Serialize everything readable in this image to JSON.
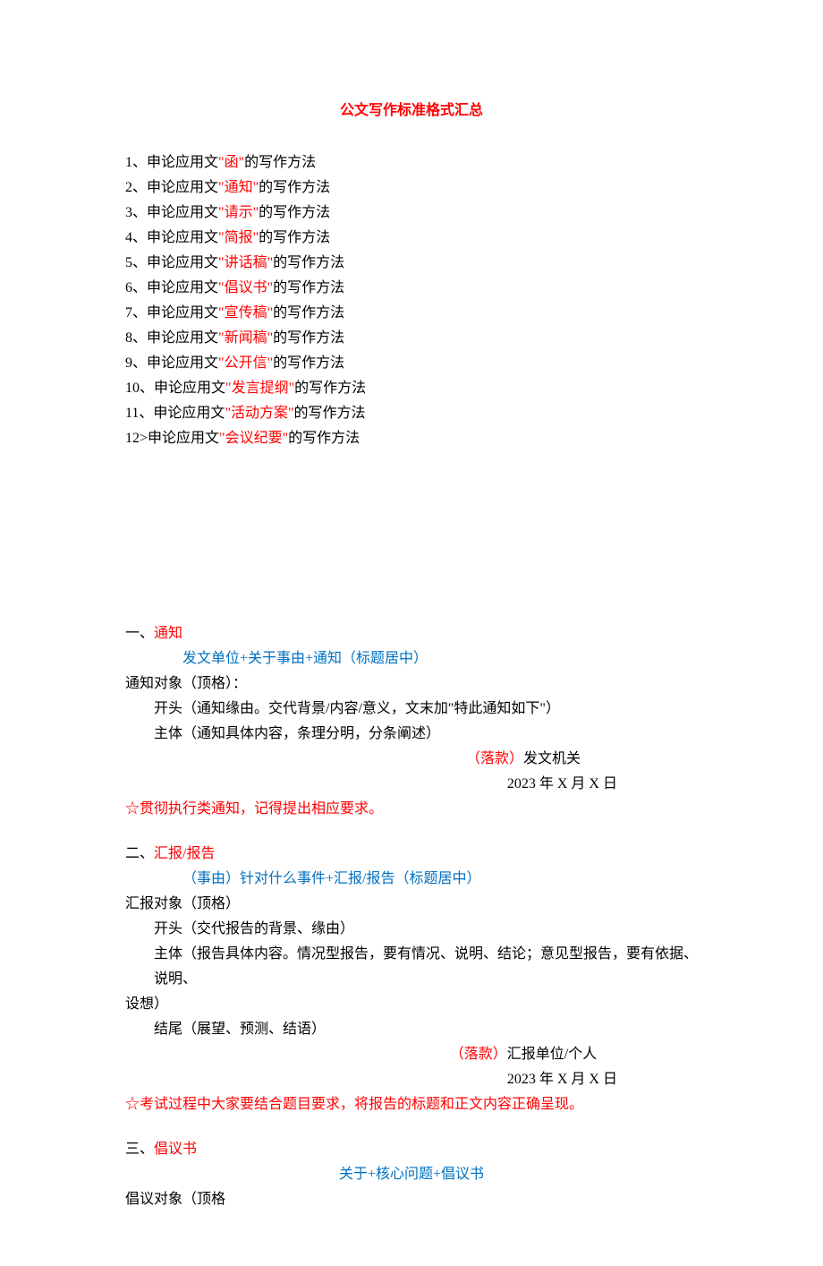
{
  "title": "公文写作标准格式汇总",
  "toc": [
    {
      "num": "1、",
      "pre": "申论应用文",
      "q1": "\"",
      "kw": "函",
      "q2": "\"",
      "suf": "的写作方法"
    },
    {
      "num": "2、",
      "pre": "申论应用文",
      "q1": "\"",
      "kw": "通知",
      "q2": "\"",
      "suf": "的写作方法"
    },
    {
      "num": "3、",
      "pre": "申论应用文",
      "q1": "\"",
      "kw": "请示",
      "q2": "\"",
      "suf": "的写作方法"
    },
    {
      "num": "4、",
      "pre": "申论应用文",
      "q1": "\"",
      "kw": "简报",
      "q2": "\"",
      "suf": "的写作方法"
    },
    {
      "num": "5、",
      "pre": "申论应用文",
      "q1": "\"",
      "kw": "讲话稿",
      "q2": "\"",
      "suf": "的写作方法"
    },
    {
      "num": "6、",
      "pre": "申论应用文",
      "q1": "\"",
      "kw": "倡议书",
      "q2": "\"",
      "suf": "的写作方法"
    },
    {
      "num": "7、",
      "pre": "申论应用文",
      "q1": "\"",
      "kw": "宣传稿",
      "q2": "\"",
      "suf": "的写作方法"
    },
    {
      "num": "8、",
      "pre": "申论应用文",
      "q1": "\"",
      "kw": "新闻稿",
      "q2": "\"",
      "suf": "的写作方法"
    },
    {
      "num": "9、",
      "pre": "申论应用文",
      "q1": "\"",
      "kw": "公开信",
      "q2": "\"",
      "suf": "的写作方法"
    },
    {
      "num": "10、",
      "pre": "申论应用文",
      "q1": "\"",
      "kw": "发言提纲",
      "q2": "\"",
      "suf": "的写作方法"
    },
    {
      "num": "11、",
      "pre": "申论应用文",
      "q1": "\"",
      "kw": "活动方案",
      "q2": "\"",
      "suf": "的写作方法"
    },
    {
      "num": "12>",
      "pre": "申论应用文",
      "q1": "\"",
      "kw": "会议纪要",
      "q2": "\"",
      "suf": "的写作方法"
    }
  ],
  "s1": {
    "head_pre": "一、",
    "head_kw": "通知",
    "title_fmt": "发文单位+关于事由+通知（标题居中）",
    "target": "通知对象（顶格）：",
    "opening": "开头（通知缘由。交代背景/内容/意义，文末加\"特此通知如下\"）",
    "body": "主体（通知具体内容，条理分明，分条阐述）",
    "sign_lbl": "（落款）",
    "sign_val": "发文机关",
    "date": "2023 年 X 月 X 日",
    "note": "☆贯彻执行类通知，记得提出相应要求。"
  },
  "s2": {
    "head_pre": "二、",
    "head_kw": "汇报/报告",
    "title_fmt": "（事由）针对什么事件+汇报/报告（标题居中）",
    "target": "汇报对象（顶格）",
    "opening": "开头（交代报告的背景、缘由）",
    "body1": "主体（报告具体内容。情况型报告，要有情况、说明、结论；意见型报告，要有依据、说明、",
    "body2": "设想）",
    "ending": "结尾（展望、预测、结语）",
    "sign_lbl": "（落款）",
    "sign_val": "汇报单位/个人",
    "date": "2023 年 X 月 X 日",
    "note": "☆考试过程中大家要结合题目要求，将报告的标题和正文内容正确呈现。"
  },
  "s3": {
    "head_pre": "三、",
    "head_kw": "倡议书",
    "title_fmt": "关于+核心问题+倡议书",
    "target": "倡议对象（顶格"
  }
}
